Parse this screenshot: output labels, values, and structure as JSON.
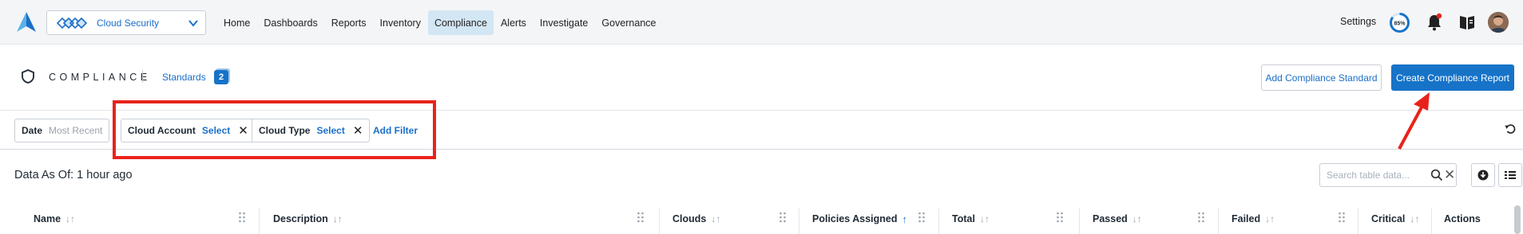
{
  "topbar": {
    "app_name": "Cloud Security",
    "nav": [
      "Home",
      "Dashboards",
      "Reports",
      "Inventory",
      "Compliance",
      "Alerts",
      "Investigate",
      "Governance"
    ],
    "active_nav": "Compliance",
    "settings_label": "Settings",
    "gauge_value": "85%",
    "gauge_fraction": 0.85,
    "notification_dot_color": "#e8231b",
    "accent_color": "#1673c8"
  },
  "page": {
    "title": "COMPLIANCE",
    "standards_label": "Standards",
    "standards_count": "2",
    "add_standard_label": "Add Compliance Standard",
    "create_report_label": "Create Compliance Report"
  },
  "filters": {
    "date": {
      "key": "Date",
      "value": "Most Recent"
    },
    "cloud_account": {
      "key": "Cloud Account",
      "value": "Select"
    },
    "cloud_type": {
      "key": "Cloud Type",
      "value": "Select"
    },
    "add_filter_label": "Add Filter"
  },
  "table": {
    "data_as_of": "Data As Of: 1 hour ago",
    "search_placeholder": "Search table data...",
    "columns": [
      "Name",
      "Description",
      "Clouds",
      "Policies Assigned",
      "Total",
      "Passed",
      "Failed",
      "Critical",
      "Actions"
    ],
    "sorted_column": "Policies Assigned"
  },
  "annotations": {
    "highlight_color": "#e8231b"
  }
}
